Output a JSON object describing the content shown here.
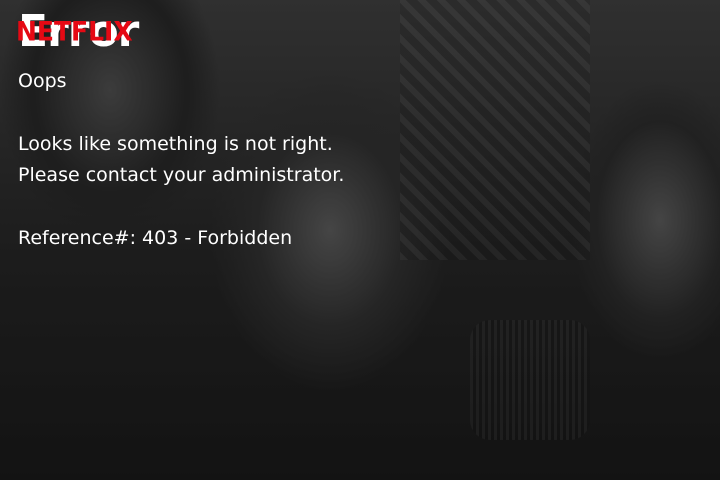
{
  "brand": {
    "logo_text": "NETFLIX",
    "logo_color": "#e50914"
  },
  "page": {
    "title": "Error",
    "subtitle": "Oops",
    "message_line1": "Looks like something is not right.",
    "message_line2": "Please contact your administrator.",
    "reference": "Reference#: 403 - Forbidden"
  },
  "colors": {
    "text": "#ffffff"
  }
}
